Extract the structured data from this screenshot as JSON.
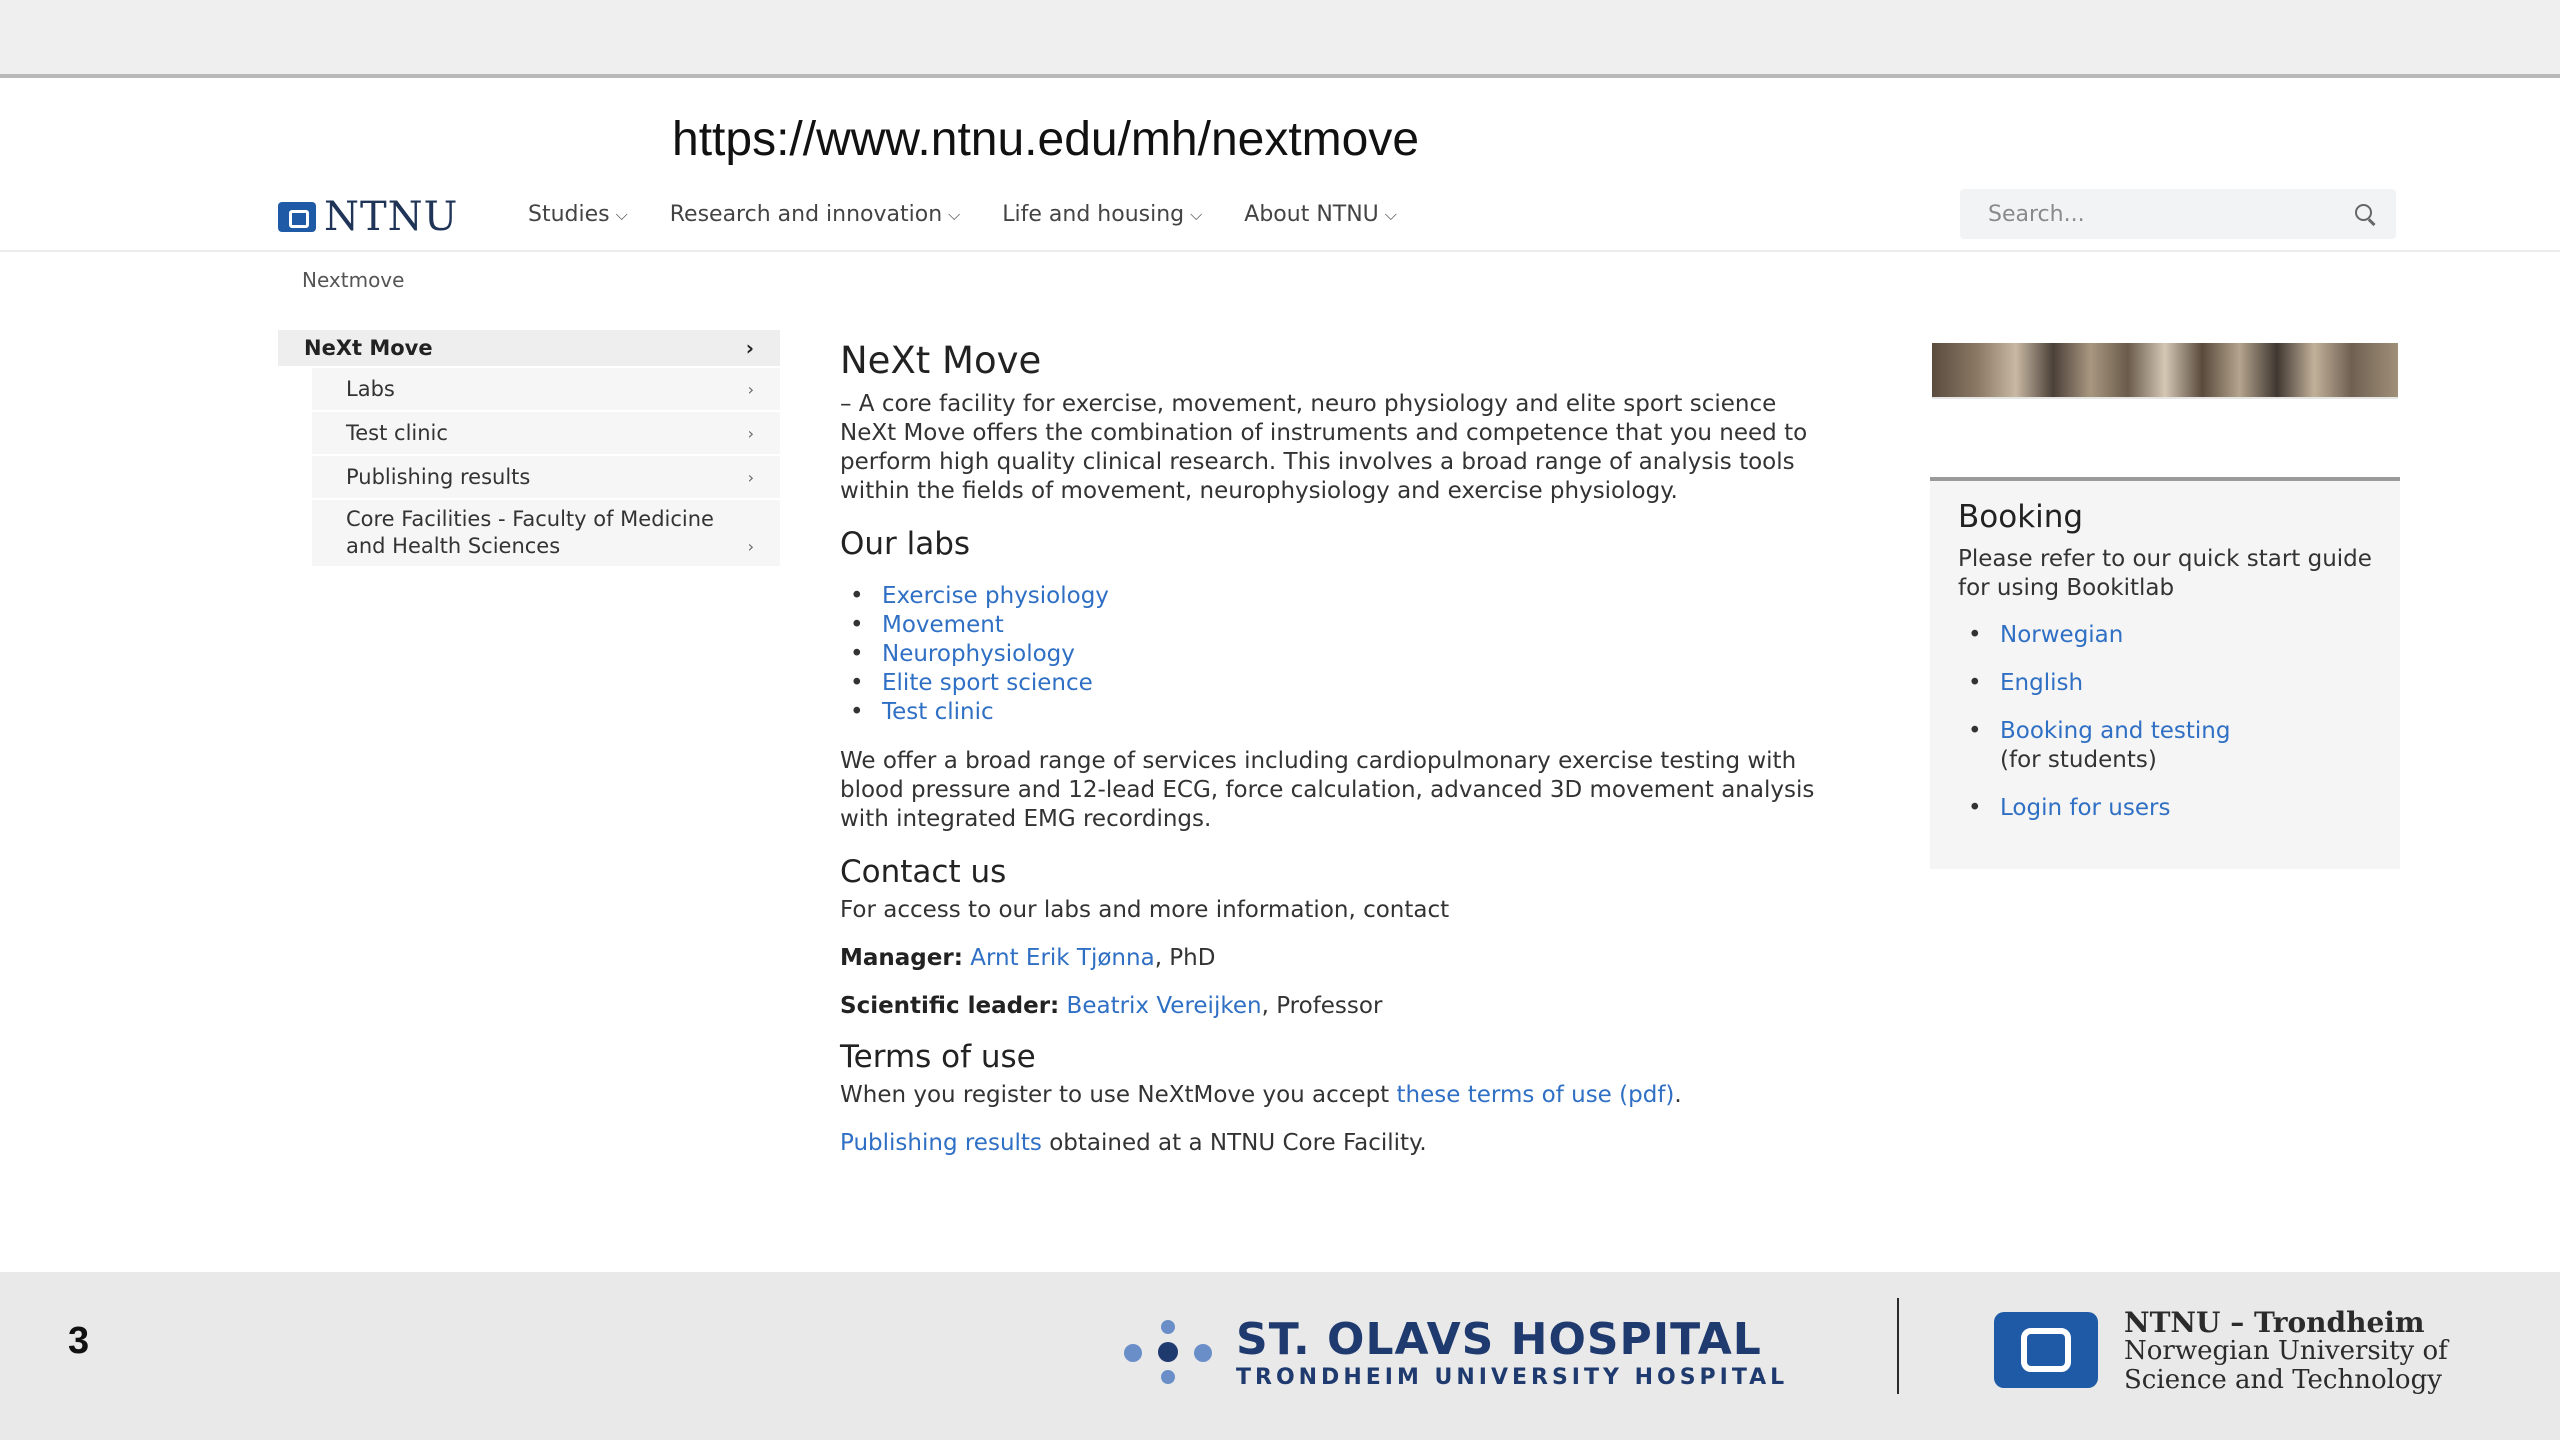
{
  "url": "https://www.ntnu.edu/mh/nextmove",
  "header": {
    "logo_text": "NTNU",
    "nav": [
      {
        "label": "Studies"
      },
      {
        "label": "Research and innovation"
      },
      {
        "label": "Life and housing"
      },
      {
        "label": "About NTNU"
      }
    ],
    "search_placeholder": "Search..."
  },
  "breadcrumb": "Nextmove",
  "leftnav": {
    "top": "NeXt Move",
    "items": [
      {
        "label": "Labs"
      },
      {
        "label": "Test clinic"
      },
      {
        "label": "Publishing results"
      },
      {
        "label": "Core Facilities - Faculty of Medicine and Health Sciences"
      }
    ]
  },
  "main": {
    "title": "NeXt Move",
    "tagline": "– A core facility for exercise, movement, neuro physiology and elite sport science",
    "intro": "NeXt Move offers the combination of instruments and competence that you need to perform high quality clinical research. This involves a broad range of analysis tools within the fields of movement, neurophysiology and exercise physiology.",
    "labs_title": "Our labs",
    "labs": [
      "Exercise physiology",
      "Movement",
      "Neurophysiology",
      "Elite sport science",
      "Test clinic"
    ],
    "services": "We offer a broad range of services including cardiopulmonary exercise testing with blood pressure and 12-lead ECG, force calculation, advanced 3D movement analysis with integrated EMG recordings.",
    "contact_title": "Contact us",
    "contact_text": "For access to our labs and more information, contact",
    "manager_label": "Manager:",
    "manager_name": "Arnt Erik Tjønna",
    "manager_suffix": ", PhD",
    "sci_label": "Scientific leader:",
    "sci_name": "Beatrix Vereijken",
    "sci_suffix": ", Professor",
    "terms_title": "Terms of use",
    "terms_text": "When you register to use NeXtMove you accept",
    "terms_link": "these terms of use (pdf)",
    "terms_end": ".",
    "pub_link": "Publishing results",
    "pub_text": " obtained at a NTNU Core Facility."
  },
  "side": {
    "title": "Booking",
    "text": "Please refer to our quick start guide for using Bookitlab",
    "links": [
      {
        "label": "Norwegian",
        "note": ""
      },
      {
        "label": "English",
        "note": ""
      },
      {
        "label": "Booking and testing",
        "note": "(for students)"
      },
      {
        "label": "Login for users",
        "note": ""
      }
    ]
  },
  "footer": {
    "page_number": "3",
    "hospital_name": "ST. OLAVS HOSPITAL",
    "hospital_sub": "TRONDHEIM UNIVERSITY HOSPITAL",
    "ntnu_line1": "NTNU – Trondheim",
    "ntnu_line2": "Norwegian University of",
    "ntnu_line3": "Science and Technology"
  }
}
